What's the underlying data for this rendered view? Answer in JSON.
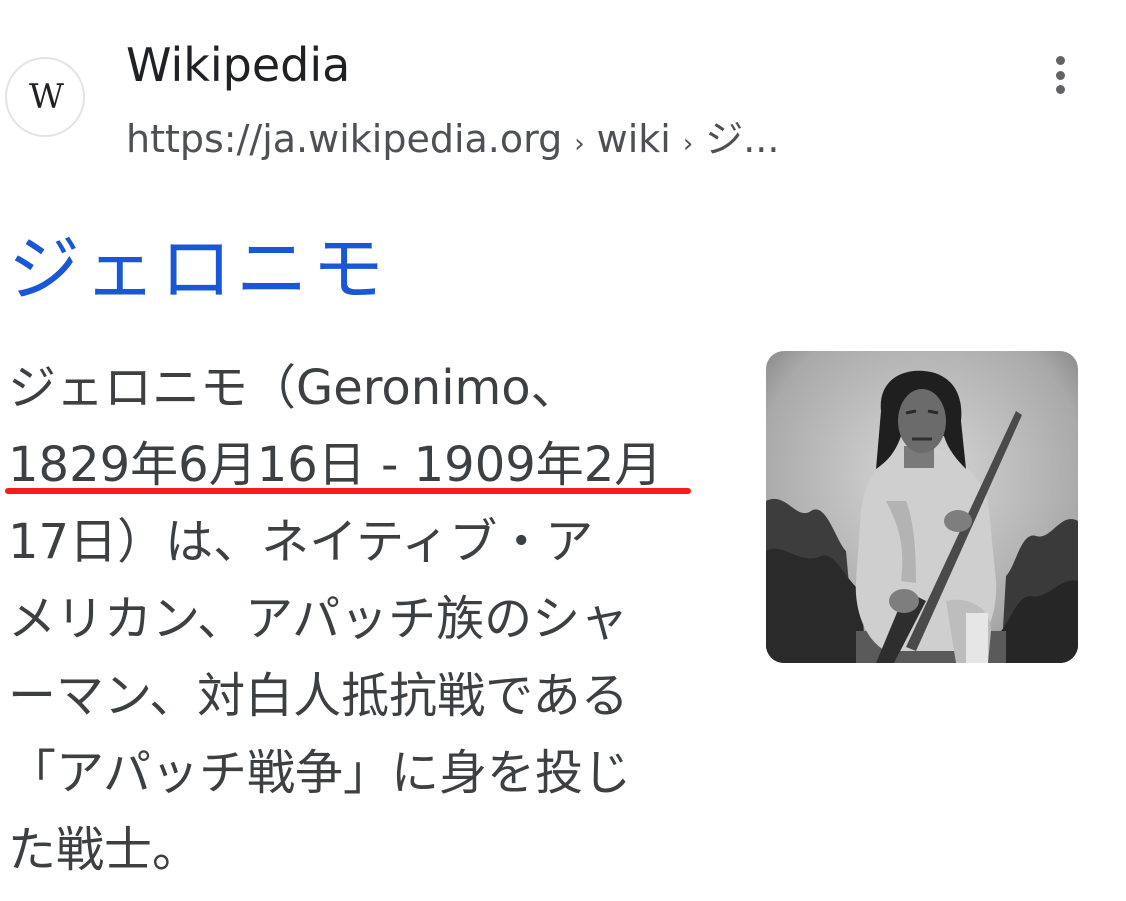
{
  "source": {
    "favicon_letter": "W",
    "name": "Wikipedia",
    "url_domain": "https://ja.wikipedia.org",
    "url_sep": "›",
    "url_path_1": "wiki",
    "url_path_2": "ジ..."
  },
  "more_icon": "more-vert-icon",
  "result": {
    "title": "ジェロニモ",
    "snippet_lines": [
      "ジェロニモ（Geronimo、",
      "1829年6月16日 - 1909年2月",
      "17日）は、ネイティブ・ア",
      "メリカン、アパッチ族のシャ",
      "ーマン、対白人抵抗戦である",
      "「アパッチ戦争」に身を投じ",
      "た戦士。"
    ]
  },
  "colors": {
    "title_link": "#1a57d6",
    "text": "#3c4043",
    "underline_annotation": "#ff1a1a"
  }
}
